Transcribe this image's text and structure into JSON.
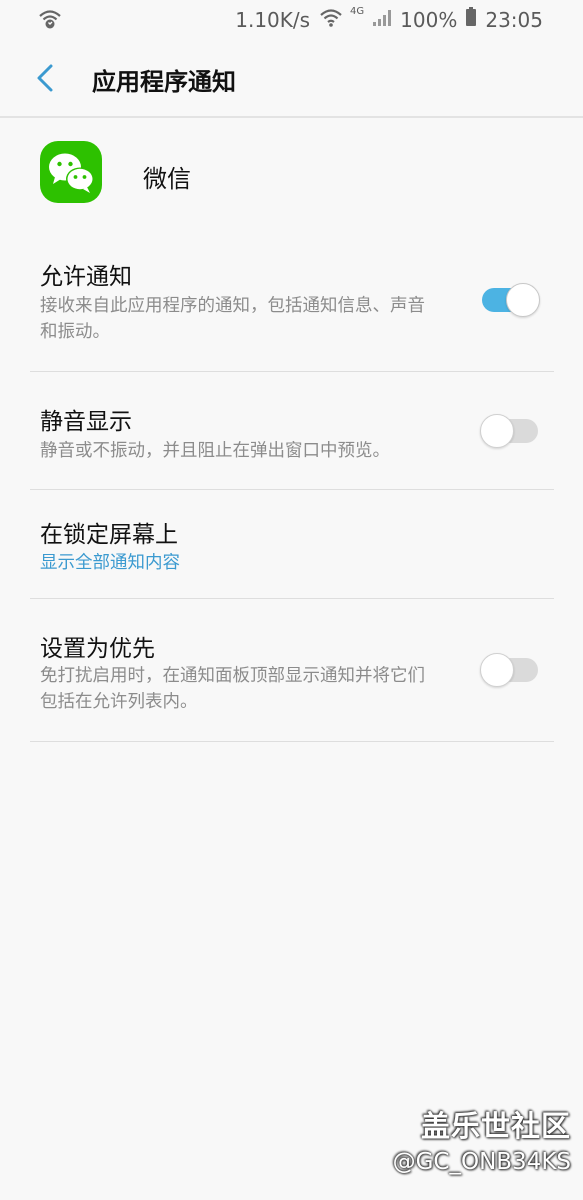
{
  "status_bar": {
    "speed": "1.10K/s",
    "network": "4G",
    "battery": "100%",
    "time": "23:05"
  },
  "app_bar": {
    "title": "应用程序通知"
  },
  "app": {
    "name": "微信",
    "icon": "wechat-icon",
    "icon_color": "#2dc100"
  },
  "settings": {
    "allow": {
      "title": "允许通知",
      "subtitle": "接收来自此应用程序的通知，包括通知信息、声音和振动。",
      "enabled": true
    },
    "silent": {
      "title": "静音显示",
      "subtitle": "静音或不振动，并且阻止在弹出窗口中预览。",
      "enabled": false
    },
    "lock_screen": {
      "title": "在锁定屏幕上",
      "value": "显示全部通知内容"
    },
    "priority": {
      "title": "设置为优先",
      "subtitle": "免打扰启用时，在通知面板顶部显示通知并将它们包括在允许列表内。",
      "enabled": false
    }
  },
  "colors": {
    "accent": "#3b9ad0",
    "toggle_on": "#4cb3e3",
    "background": "#f8f8f8"
  },
  "watermark": {
    "line1": "盖乐世社区",
    "line2": "@GC_ONB34KS"
  }
}
